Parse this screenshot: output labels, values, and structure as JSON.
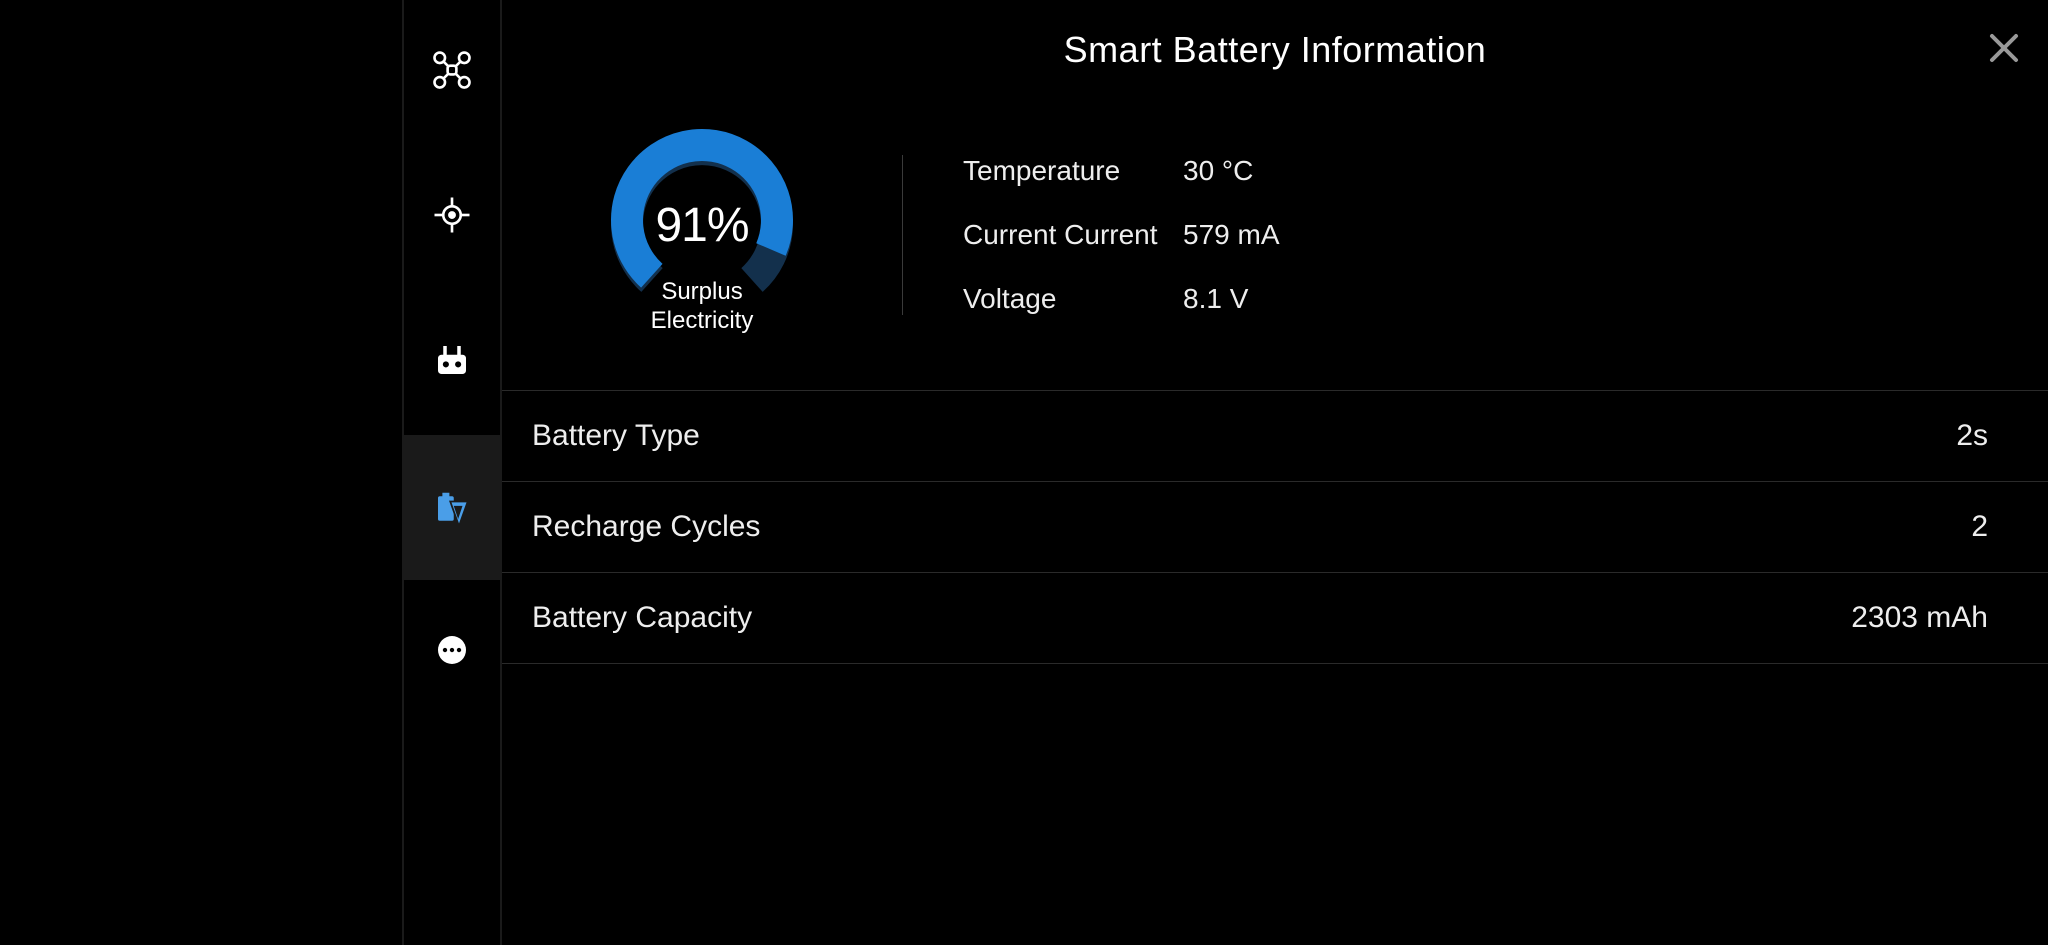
{
  "header": {
    "title": "Smart Battery Information"
  },
  "gauge": {
    "percentage": "91%",
    "percent_value": 91,
    "label_line1": "Surplus",
    "label_line2": "Electricity"
  },
  "stats": {
    "temperature": {
      "label": "Temperature",
      "value": "30 °C"
    },
    "current": {
      "label": "Current Current",
      "value": "579 mA"
    },
    "voltage": {
      "label": "Voltage",
      "value": "8.1 V"
    }
  },
  "rows": {
    "battery_type": {
      "label": "Battery Type",
      "value": "2s"
    },
    "recharge_cycles": {
      "label": "Recharge Cycles",
      "value": "2"
    },
    "battery_capacity": {
      "label": "Battery Capacity",
      "value": "2303 mAh"
    }
  },
  "colors": {
    "accent": "#1a7ed6",
    "accent_light": "#4a9ee8",
    "gauge_bg": "#1a3455"
  }
}
